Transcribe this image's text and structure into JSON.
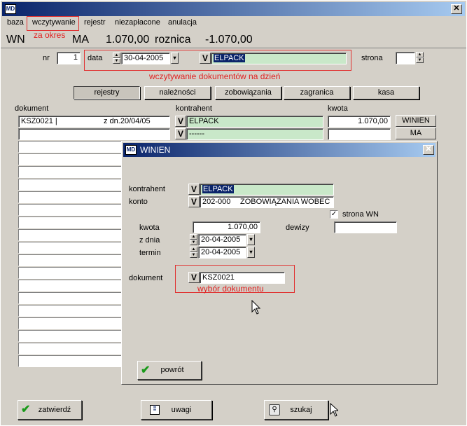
{
  "app_icon": "MD",
  "menu": {
    "items": [
      "baza",
      "wczytywanie",
      "rejestr",
      "niezapłacone",
      "anulacja"
    ]
  },
  "annotations": {
    "za_okres": "za okres",
    "dokumenty_na_dzien": "wczytywanie dokumentów na dzień",
    "wybor_dokumentu": "wybór dokumentu"
  },
  "summary": {
    "wn_label": "WN",
    "ma_label": "MA",
    "ma_value": "1.070,00",
    "roznica_label": "roznica",
    "roznica_value": "-1.070,00"
  },
  "header": {
    "nr_label": "nr",
    "nr_value": "1",
    "data_label": "data",
    "data_value": "30-04-2005",
    "contractor": "ELPACK",
    "strona_label": "strona",
    "strona_value": ""
  },
  "tabs": [
    "rejestry",
    "należności",
    "zobowiązania",
    "zagranica",
    "kasa"
  ],
  "columns": {
    "dokument": "dokument",
    "kontrahent": "kontrahent",
    "kwota": "kwota"
  },
  "rows": [
    {
      "dokument": "KSZ0021 |",
      "date": "z dn.20/04/05",
      "kontrahent": "ELPACK",
      "kwota": "1.070,00",
      "side": "WINIEN"
    },
    {
      "dokument": "",
      "date": "",
      "kontrahent": "------",
      "kwota": "",
      "side": "MA"
    }
  ],
  "dialog": {
    "icon": "MD",
    "title": "WINIEN",
    "kontrahent_label": "kontrahent",
    "kontrahent_value": "ELPACK",
    "konto_label": "konto",
    "konto_number": "202-000",
    "konto_name": "ZOBOWIĄZANIA WOBEC",
    "strona_wn_label": "strona WN",
    "strona_wn_checked": "✓",
    "kwota_label": "kwota",
    "kwota_value": "1.070,00",
    "dewizy_label": "dewizy",
    "dewizy_value": "",
    "z_dnia_label": "z dnia",
    "z_dnia_value": "20-04-2005",
    "termin_label": "termin",
    "termin_value": "20-04-2005",
    "dokument_label": "dokument",
    "dokument_value": "KSZ0021",
    "powrot_label": "powrót"
  },
  "footer": {
    "zatwierdz_label": "zatwierdź",
    "uwagi_label": "uwagi",
    "szukaj_label": "szukaj"
  },
  "colors": {
    "green_field": "#c9e8c9",
    "annotation_red": "#e02020",
    "title_blue": "#0a246a"
  }
}
